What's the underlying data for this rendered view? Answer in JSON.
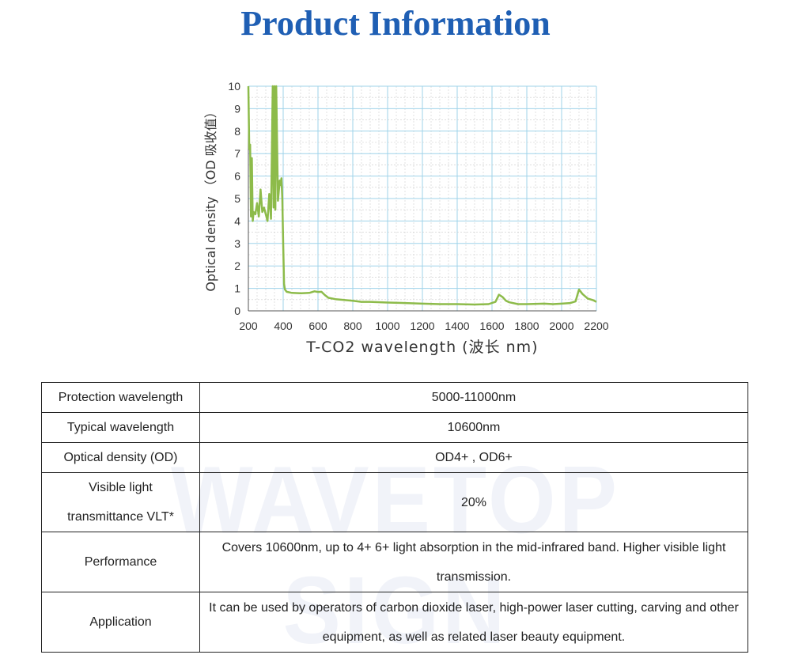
{
  "title": "Product Information",
  "watermark": "WAVETOP SIGN",
  "chart_data": {
    "type": "line",
    "xlabel": "T-CO2 wavelength (波长 nm)",
    "ylabel": "Optical density （OD 吸收值）",
    "xlim": [
      200,
      2200
    ],
    "ylim": [
      0,
      10
    ],
    "xticks": [
      200,
      400,
      600,
      800,
      1000,
      1200,
      1400,
      1600,
      1800,
      2000,
      2200
    ],
    "yticks": [
      0,
      1,
      2,
      3,
      4,
      5,
      6,
      7,
      8,
      9,
      10
    ],
    "grid": true,
    "color": "#8dbb4a",
    "x": [
      200,
      205,
      210,
      215,
      220,
      225,
      230,
      240,
      250,
      260,
      270,
      280,
      290,
      300,
      310,
      320,
      330,
      340,
      345,
      350,
      355,
      360,
      370,
      380,
      385,
      390,
      395,
      400,
      405,
      410,
      420,
      450,
      500,
      550,
      580,
      600,
      620,
      640,
      660,
      700,
      800,
      850,
      900,
      1000,
      1100,
      1200,
      1300,
      1400,
      1500,
      1580,
      1620,
      1640,
      1660,
      1680,
      1700,
      1750,
      1800,
      1900,
      1950,
      2000,
      2050,
      2080,
      2100,
      2120,
      2150,
      2180,
      2200
    ],
    "y": [
      10,
      7.2,
      7.4,
      4.2,
      6.8,
      4.0,
      4.4,
      4.3,
      4.8,
      4.2,
      5.4,
      4.4,
      4.6,
      4.3,
      4.0,
      5.2,
      4.1,
      10,
      4.6,
      10,
      4.5,
      10,
      4.9,
      5.8,
      5.6,
      5.9,
      5.0,
      3.0,
      1.2,
      0.95,
      0.85,
      0.8,
      0.78,
      0.8,
      0.87,
      0.84,
      0.85,
      0.7,
      0.58,
      0.52,
      0.45,
      0.4,
      0.4,
      0.37,
      0.35,
      0.32,
      0.3,
      0.3,
      0.28,
      0.3,
      0.4,
      0.72,
      0.62,
      0.45,
      0.38,
      0.3,
      0.3,
      0.32,
      0.3,
      0.32,
      0.35,
      0.42,
      0.95,
      0.75,
      0.55,
      0.48,
      0.4
    ]
  },
  "table": [
    {
      "label": "Protection wavelength",
      "value": "5000-11000nm"
    },
    {
      "label": "Typical wavelength",
      "value": "10600nm"
    },
    {
      "label": "Optical density (OD)",
      "value": "OD4+ , OD6+"
    },
    {
      "label": "Visible light transmittance VLT*",
      "value": "20%"
    },
    {
      "label": "Performance",
      "value": "Covers 10600nm, up to 4+ 6+ light absorption in the mid-infrared band. Higher visible light transmission."
    },
    {
      "label": "Application",
      "value": "It can be used by operators of carbon dioxide laser, high-power laser cutting, carving and other equipment, as well as related laser beauty equipment."
    }
  ]
}
